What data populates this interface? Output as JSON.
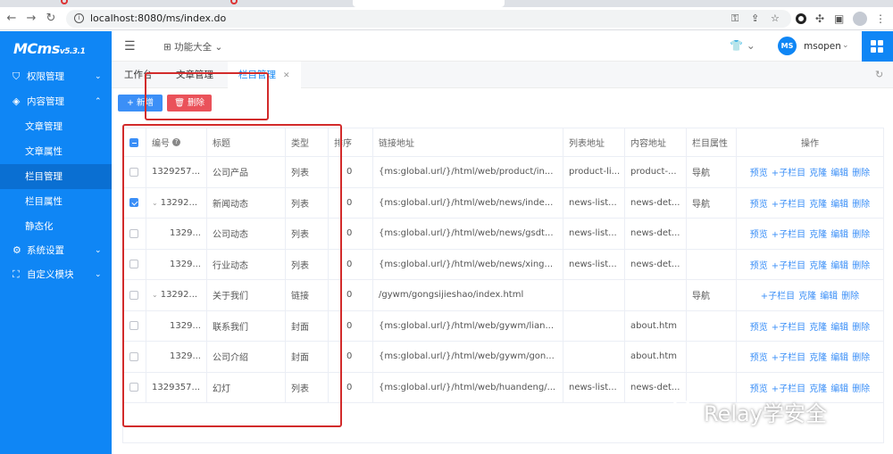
{
  "browser": {
    "url": "localhost:8080/ms/index.do"
  },
  "sidebar": {
    "logo": "MCms",
    "version": "v5.3.1",
    "items": [
      {
        "label": "权限管理",
        "icon": "shield-icon"
      },
      {
        "label": "内容管理",
        "icon": "layers-icon"
      },
      {
        "label": "系统设置",
        "icon": "gear-icon"
      },
      {
        "label": "自定义模块",
        "icon": "module-icon"
      }
    ],
    "sub_items": [
      {
        "label": "文章管理"
      },
      {
        "label": "文章属性"
      },
      {
        "label": "栏目管理"
      },
      {
        "label": "栏目属性"
      },
      {
        "label": "静态化"
      }
    ]
  },
  "header": {
    "function_menu": "功能大全",
    "user_avatar": "MS",
    "user_name": "msopen"
  },
  "tabs": [
    {
      "label": "工作台"
    },
    {
      "label": "文章管理"
    },
    {
      "label": "栏目管理"
    }
  ],
  "toolbar": {
    "add_label": "新增",
    "delete_label": "删除"
  },
  "table": {
    "headers": [
      "编号",
      "标题",
      "类型",
      "排序",
      "链接地址",
      "列表地址",
      "内容地址",
      "栏目属性",
      "操作"
    ],
    "ops": {
      "preview": "预览",
      "add_child": "子栏目",
      "clone": "克隆",
      "edit": "编辑",
      "delete": "删除"
    },
    "rows": [
      {
        "id": "1329257...",
        "title": "公司产品",
        "type": "列表",
        "sort": "0",
        "link": "{ms:global.url/}/html/web/product/in...",
        "list": "product-li...",
        "content": "product-...",
        "attr": "导航",
        "checked": false,
        "caret": false,
        "preview": true
      },
      {
        "id": "13292...",
        "title": "新闻动态",
        "type": "列表",
        "sort": "0",
        "link": "{ms:global.url/}/html/web/news/inde...",
        "list": "news-list...",
        "content": "news-det...",
        "attr": "导航",
        "checked": true,
        "caret": true,
        "preview": true
      },
      {
        "id": "1329...",
        "title": "公司动态",
        "type": "列表",
        "sort": "0",
        "link": "{ms:global.url/}/html/web/news/gsdt...",
        "list": "news-list...",
        "content": "news-det...",
        "attr": "",
        "checked": false,
        "caret": false,
        "preview": true
      },
      {
        "id": "1329...",
        "title": "行业动态",
        "type": "列表",
        "sort": "0",
        "link": "{ms:global.url/}/html/web/news/xing...",
        "list": "news-list...",
        "content": "news-det...",
        "attr": "",
        "checked": false,
        "caret": false,
        "preview": true
      },
      {
        "id": "13292...",
        "title": "关于我们",
        "type": "链接",
        "sort": "0",
        "link": "/gywm/gongsijieshao/index.html",
        "list": "",
        "content": "",
        "attr": "导航",
        "checked": false,
        "caret": true,
        "preview": false
      },
      {
        "id": "1329...",
        "title": "联系我们",
        "type": "封面",
        "sort": "0",
        "link": "{ms:global.url/}/html/web/gywm/lian...",
        "list": "",
        "content": "about.htm",
        "attr": "",
        "checked": false,
        "caret": false,
        "preview": true
      },
      {
        "id": "1329...",
        "title": "公司介绍",
        "type": "封面",
        "sort": "0",
        "link": "{ms:global.url/}/html/web/gywm/gon...",
        "list": "",
        "content": "about.htm",
        "attr": "",
        "checked": false,
        "caret": false,
        "preview": true
      },
      {
        "id": "1329357...",
        "title": "幻灯",
        "type": "列表",
        "sort": "0",
        "link": "{ms:global.url/}/html/web/huandeng/...",
        "list": "news-list...",
        "content": "news-det...",
        "attr": "",
        "checked": false,
        "caret": false,
        "preview": true
      }
    ]
  },
  "watermark": {
    "text": "Relay学安全"
  },
  "colors": {
    "primary": "#0f86f5",
    "danger": "#ea525a",
    "annotation": "#d22b2b"
  }
}
